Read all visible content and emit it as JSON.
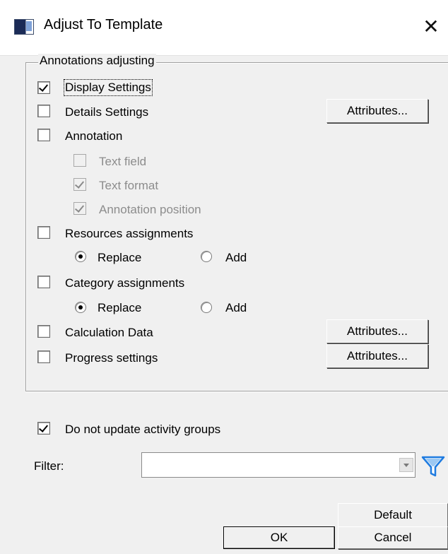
{
  "window": {
    "title": "Adjust To Template",
    "close_glyph": "✕",
    "icon": "window-app-icon"
  },
  "annotations_group": {
    "legend": "Annotations adjusting",
    "display_settings": {
      "label": "Display Settings",
      "checked": true
    },
    "details_settings": {
      "label": "Details Settings",
      "checked": false,
      "button": "Attributes..."
    },
    "annotation": {
      "label": "Annotation",
      "checked": false
    },
    "text_field": {
      "label": "Text field",
      "checked": false,
      "disabled": true
    },
    "text_format": {
      "label": "Text format",
      "checked": true,
      "disabled": true
    },
    "annotation_position": {
      "label": "Annotation position",
      "checked": true,
      "disabled": true
    },
    "resources_assignments": {
      "label": "Resources assignments",
      "checked": false,
      "replace_label": "Replace",
      "add_label": "Add",
      "selected": "Replace"
    },
    "category_assignments": {
      "label": "Category assignments",
      "checked": false,
      "replace_label": "Replace",
      "add_label": "Add",
      "selected": "Replace"
    },
    "calculation_data": {
      "label": "Calculation Data",
      "checked": false,
      "button": "Attributes..."
    },
    "progress_settings": {
      "label": "Progress settings",
      "checked": false,
      "button": "Attributes..."
    }
  },
  "do_not_update": {
    "label": "Do not update activity groups",
    "checked": true
  },
  "filter": {
    "label": "Filter:",
    "value": ""
  },
  "buttons": {
    "default": "Default",
    "ok": "OK",
    "cancel": "Cancel"
  },
  "colors": {
    "background": "#f0f0f0",
    "filter_icon": "#1e7be0"
  }
}
